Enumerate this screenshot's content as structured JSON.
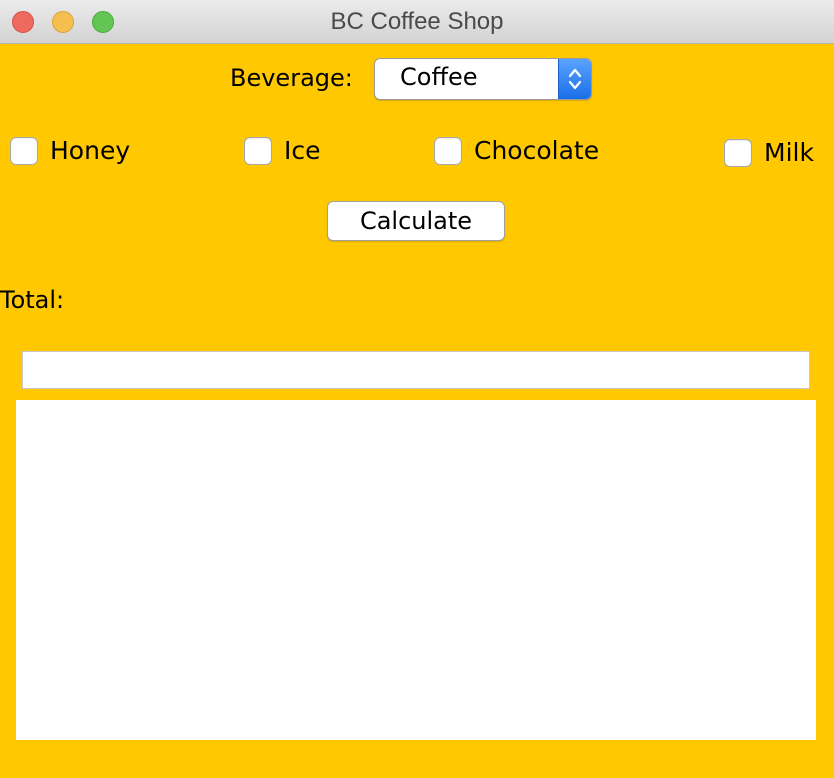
{
  "window": {
    "title": "BC Coffee Shop"
  },
  "beverage": {
    "label": "Beverage:",
    "selected": "Coffee"
  },
  "addons": [
    {
      "label": "Honey",
      "checked": false
    },
    {
      "label": "Ice",
      "checked": false
    },
    {
      "label": "Chocolate",
      "checked": false
    },
    {
      "label": "Milk",
      "checked": false
    }
  ],
  "actions": {
    "calculate_label": "Calculate"
  },
  "total": {
    "label": "Total:",
    "value": "",
    "output": ""
  },
  "colors": {
    "background": "#ffc800",
    "select_accent": "#1a6fe8"
  },
  "icons": {
    "close": "close-icon",
    "minimize": "minimize-icon",
    "zoom": "zoom-icon",
    "select_arrows": "chevron-up-down-icon"
  }
}
